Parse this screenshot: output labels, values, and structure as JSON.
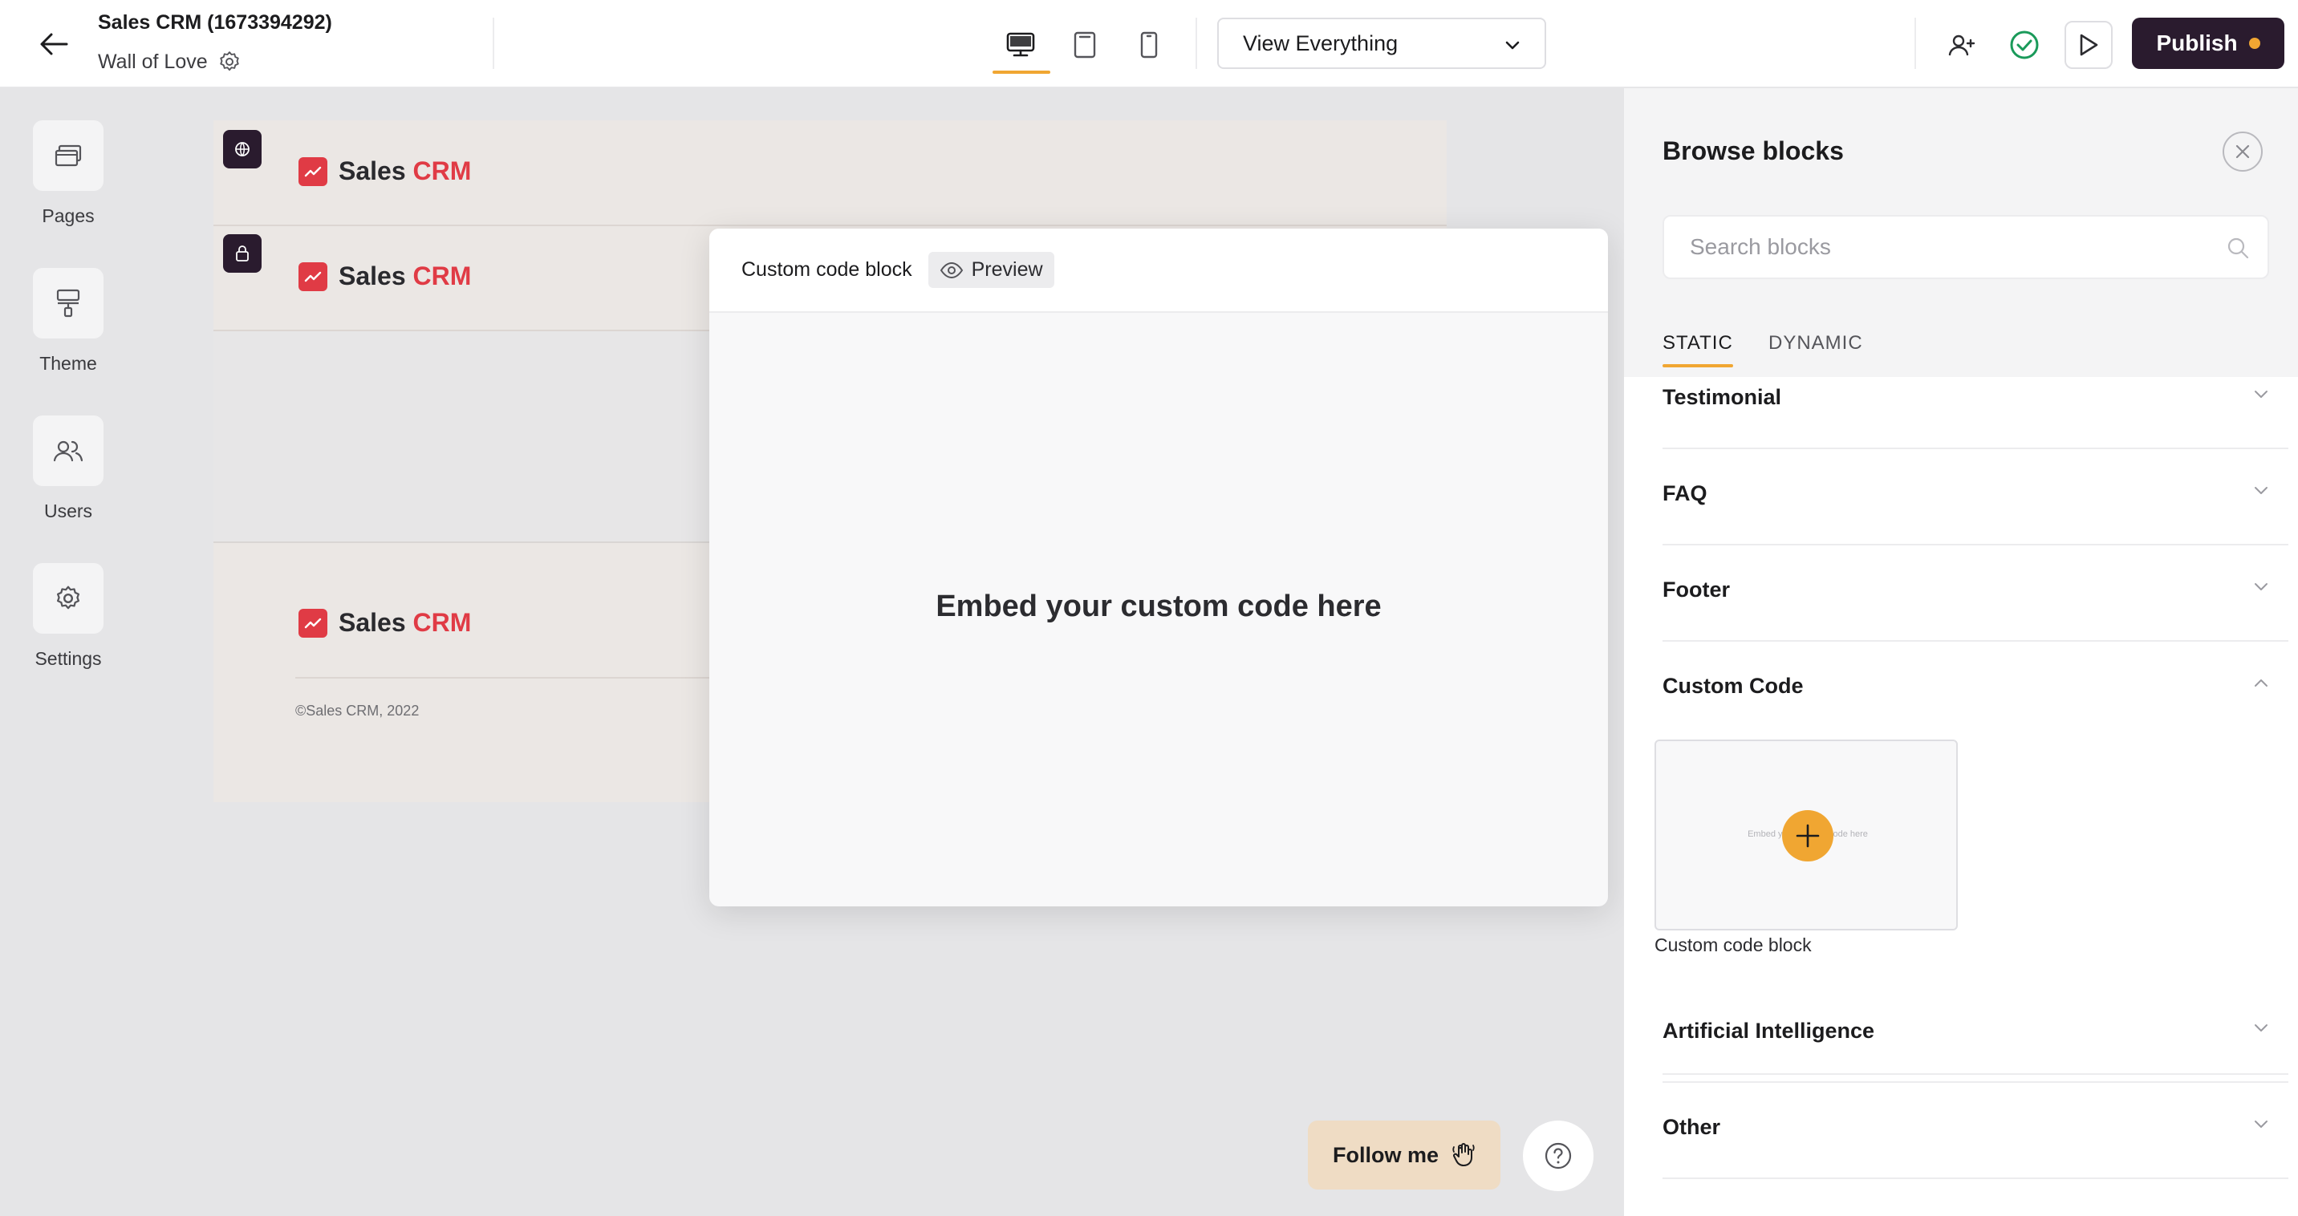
{
  "header": {
    "project_title": "Sales CRM (1673394292)",
    "page_name": "Wall of Love",
    "view_select": "View Everything",
    "publish_label": "Publish"
  },
  "sidebar": {
    "items": [
      {
        "label": "Pages",
        "icon": "pages-icon"
      },
      {
        "label": "Theme",
        "icon": "paint-roller-icon"
      },
      {
        "label": "Users",
        "icon": "users-icon"
      },
      {
        "label": "Settings",
        "icon": "gear-icon"
      }
    ]
  },
  "site": {
    "brand_first": "Sales",
    "brand_second": "CRM",
    "copyright": "©Sales CRM, 2022"
  },
  "modal": {
    "title": "Custom code block",
    "preview_label": "Preview",
    "body_text": "Embed your custom code here"
  },
  "floating": {
    "follow_label": "Follow me"
  },
  "panel": {
    "title": "Browse blocks",
    "search_placeholder": "Search blocks",
    "tabs": [
      "STATIC",
      "DYNAMIC"
    ],
    "sections": [
      {
        "label": "Testimonial",
        "expanded": false
      },
      {
        "label": "FAQ",
        "expanded": false
      },
      {
        "label": "Footer",
        "expanded": false
      },
      {
        "label": "Custom Code",
        "expanded": true
      },
      {
        "label": "Artificial Intelligence",
        "expanded": false
      },
      {
        "label": "Other",
        "expanded": false
      }
    ],
    "custom_code_card": {
      "thumbnail_text": "Embed your custom code here",
      "caption": "Custom code block"
    }
  },
  "colors": {
    "accent": "#f0a632",
    "brand_dark": "#2a1b2e",
    "brand_red": "#e03b45",
    "status_green": "#1a9a5a"
  }
}
